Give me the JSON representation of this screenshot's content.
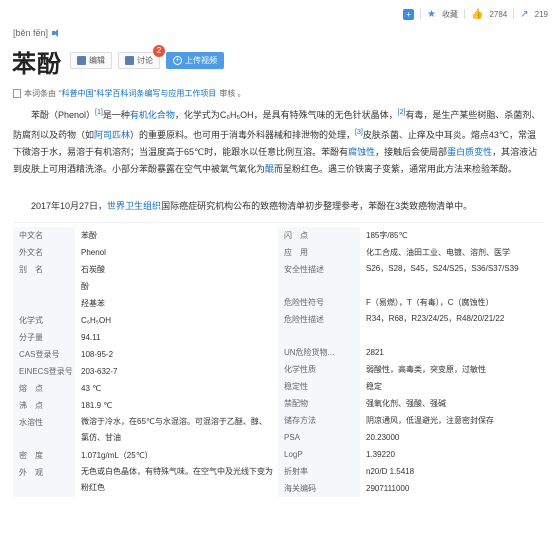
{
  "topbar": {
    "favorite": "收藏",
    "like_count": "2784",
    "share_count": "219"
  },
  "pinyin": "[běn fēn]",
  "title": "苯酚",
  "buttons": {
    "edit": "编辑",
    "discuss": "讨论",
    "discuss_badge": "2",
    "upload": "上传视频"
  },
  "note": {
    "prefix": "本词条由",
    "link": "“科普中国”科学百科词条编写与应用工作项目",
    "suffix": "审核 。"
  },
  "para1": {
    "t1": "苯酚（Phenol）",
    "s1": "[1]",
    "t2": "是一种",
    "l1": "有机化合物",
    "t3": "，化学式为C₆H₅OH，是具有特殊气味的无色针状晶体，",
    "s2": "[2]",
    "t4": "有毒，是生产某些树脂、杀菌剂、防腐剂以及药物（如",
    "l2": "阿司匹林",
    "t5": "）的重要原料。也可用于消毒外科器械和排泄物的处理，",
    "s3": "[3]",
    "t6": "皮肤杀菌、止痒及中耳炎。熔点43℃，常温下微溶于水，易溶于有机溶剂；当温度高于65℃时，能跟水以任意比例互溶。苯酚有",
    "l3": "腐蚀性",
    "t7": "，接触后会使局部",
    "l4": "蛋白质变性",
    "t8": "，其溶液沾到皮肤上可用酒精洗涤。小部分苯酚暴露在空气中被氧气氧化为",
    "l5": "醌",
    "t9": "而呈粉红色。遇三价铁离子变紫，通常用此方法来检验苯酚。"
  },
  "para2": {
    "t1": "2017年10月27日，",
    "l1": "世界卫生组织",
    "t2": "国际癌症研究机构公布的致癌物清单初步整理参考，苯酚在3类致癌物清单中。"
  },
  "info_left": [
    {
      "k": "中文名",
      "v": "苯酚"
    },
    {
      "k": "外文名",
      "v": "Phenol"
    },
    {
      "k": "别　名",
      "v": "石炭酸"
    },
    {
      "k": "",
      "v": "酚"
    },
    {
      "k": "",
      "v": "羟基苯"
    },
    {
      "k": "化学式",
      "v": "C₆H₅OH"
    },
    {
      "k": "分子量",
      "v": "94.11"
    },
    {
      "k": "CAS登录号",
      "v": "108-95-2"
    },
    {
      "k": "EINECS登录号",
      "v": "203-632-7"
    },
    {
      "k": "熔　点",
      "v": "43 ℃"
    },
    {
      "k": "沸　点",
      "v": "181.9 ℃"
    },
    {
      "k": "水溶性",
      "v": "微溶于冷水，在65℃与水混溶。可混溶于乙醚、醇、氯仿、甘油"
    },
    {
      "k": "密　度",
      "v": "1.071g/mL（25℃）"
    },
    {
      "k": "外　观",
      "v": "无色或白色晶体，有特殊气味。在空气中及光线下变为粉红色"
    }
  ],
  "info_right": [
    {
      "k": "闪　点",
      "v": "185字/85℃"
    },
    {
      "k": "应　用",
      "v": "化工合成、油田工业、电镀、溶剂、医学"
    },
    {
      "k": "安全性描述",
      "v": "S26，S28，S45，S24/S25，S36/S37/S39"
    },
    {
      "k": "危险性符号",
      "v": "F（易燃），T（有毒），C（腐蚀性）"
    },
    {
      "k": "危险性描述",
      "v": "R34，R68，R23/24/25，R48/20/21/22"
    },
    {
      "k": "UN危险货物...",
      "v": "2821"
    },
    {
      "k": "化学性质",
      "v": "弱酸性，高毒类，突变原，过敏性"
    },
    {
      "k": "稳定性",
      "v": "稳定"
    },
    {
      "k": "禁配物",
      "v": "强氧化剂、强酸、强碱"
    },
    {
      "k": "储存方法",
      "v": "阴凉通风，低温避光，注意密封保存"
    },
    {
      "k": "PSA",
      "v": "20.23000"
    },
    {
      "k": "LogP",
      "v": "1.39220"
    },
    {
      "k": "折射率",
      "v": "n20/D 1.5418"
    },
    {
      "k": "海关编码",
      "v": "2907111000"
    }
  ]
}
